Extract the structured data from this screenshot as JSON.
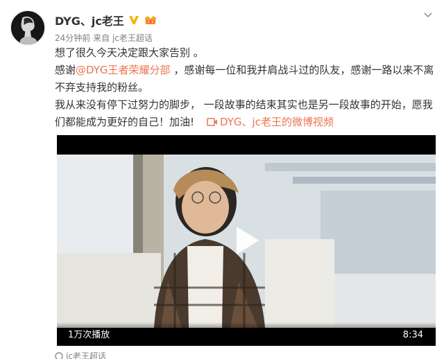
{
  "post": {
    "username": "DYG、jc老王",
    "badges": [
      "verified-v-icon",
      "member-crown-icon"
    ],
    "time": "24分钟前",
    "source_prefix": "来自",
    "source": "jc老王超话",
    "lines": [
      "想了很久今天决定跟大家告别 。",
      "感谢",
      "@DYG王者荣耀分部",
      " ，感谢每一位和我并肩战斗过的队友，感谢一路以来不离不弃支持我的粉丝。",
      "我从来没有停下过努力的脚步， 一段故事的结束其实也是另一段故事的开始，愿我们都能成为更好的自己！加油!"
    ],
    "video_link": "DYG、jc老王的微博视频"
  },
  "video": {
    "play_count": "1万次播放",
    "duration": "8:34"
  },
  "footer": {
    "source_cut": "jc老王超话"
  },
  "colors": {
    "link": "#eb7350",
    "text": "#333333",
    "meta": "#808080",
    "verified": "#f7b500"
  }
}
